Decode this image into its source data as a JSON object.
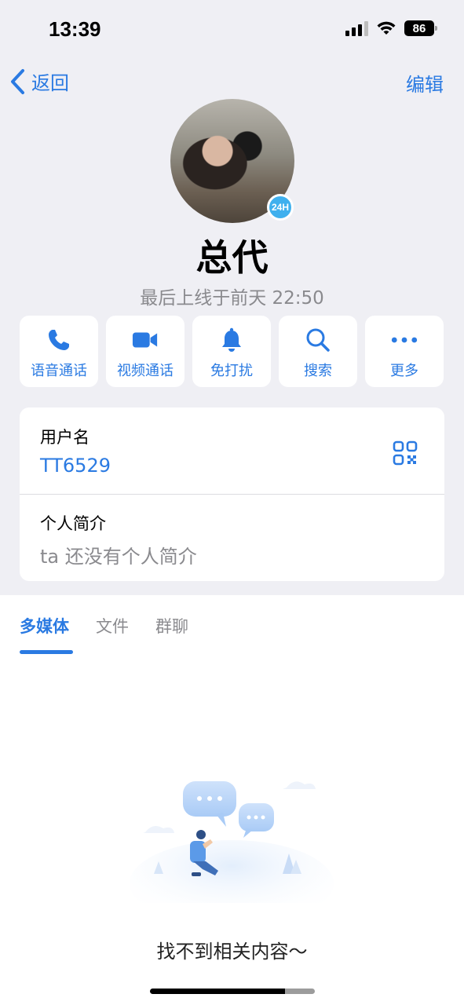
{
  "status_bar": {
    "time": "13:39",
    "battery": "86"
  },
  "nav": {
    "back_label": "返回",
    "edit_label": "编辑"
  },
  "profile": {
    "name": "总代",
    "last_seen": "最后上线于前天 22:50",
    "avatar_badge": "24H"
  },
  "actions": [
    {
      "label": "语音通话",
      "icon": "phone-icon"
    },
    {
      "label": "视频通话",
      "icon": "video-camera-icon"
    },
    {
      "label": "免打扰",
      "icon": "bell-icon"
    },
    {
      "label": "搜索",
      "icon": "search-icon"
    },
    {
      "label": "更多",
      "icon": "more-dots-icon"
    }
  ],
  "info": {
    "username_label": "用户名",
    "username_value": "TT6529",
    "bio_label": "个人简介",
    "bio_value": "ta 还没有个人简介"
  },
  "tabs": [
    {
      "label": "多媒体",
      "active": true
    },
    {
      "label": "文件",
      "active": false
    },
    {
      "label": "群聊",
      "active": false
    }
  ],
  "empty_state": {
    "text": "找不到相关内容～"
  },
  "colors": {
    "accent": "#2a7ae2",
    "background": "#efeff4",
    "secondary_text": "#8a8a8e"
  }
}
